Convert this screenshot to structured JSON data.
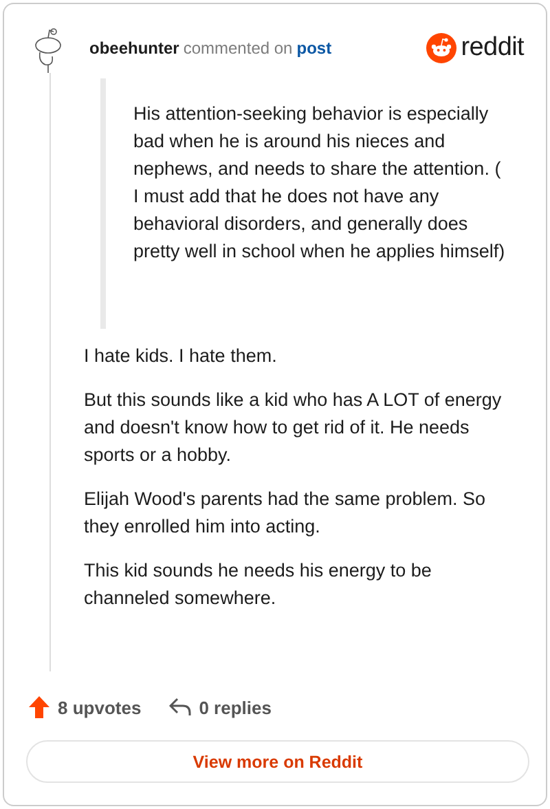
{
  "header": {
    "username": "obeehunter",
    "action": "commented on",
    "link": "post",
    "brand": "reddit"
  },
  "quote": "His attention-seeking behavior is especially bad when he is around his nieces and nephews, and needs to share the attention. ( I must add that he does not have any behavioral disorders, and generally does pretty well in school when he applies himself)",
  "paragraphs": [
    "I hate kids. I hate them.",
    "But this sounds like a kid who has A LOT of energy and doesn't know how to get rid of it. He needs sports or a hobby.",
    "Elijah Wood's parents had the same problem. So they enrolled him into acting.",
    "This kid sounds he needs his energy to be channeled somewhere."
  ],
  "footer": {
    "upvotes": "8 upvotes",
    "replies": "0 replies"
  },
  "button": "View more on Reddit"
}
